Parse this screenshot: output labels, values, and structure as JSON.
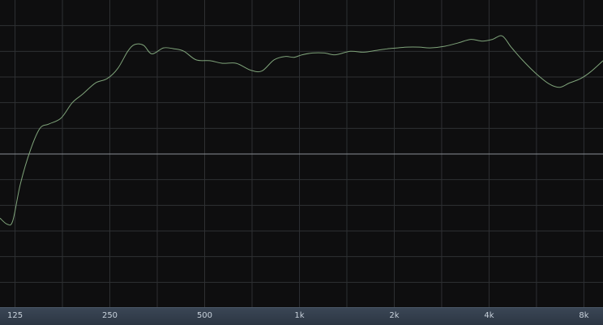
{
  "chart_data": {
    "type": "line",
    "xscale": "log",
    "xlim": [
      112,
      9200
    ],
    "ylim": [
      -18,
      18
    ],
    "grid": true,
    "x_tick_labels": [
      {
        "label": "125",
        "value": 125
      },
      {
        "label": "250",
        "value": 250
      },
      {
        "label": "500",
        "value": 500
      },
      {
        "label": "1k",
        "value": 1000
      },
      {
        "label": "2k",
        "value": 2000
      },
      {
        "label": "4k",
        "value": 4000
      },
      {
        "label": "8k",
        "value": 8000
      }
    ],
    "series": [
      {
        "color": "#7fa37a",
        "x": [
          112,
          118,
          123,
          130,
          140,
          150,
          160,
          175,
          190,
          205,
          225,
          245,
          265,
          285,
          300,
          320,
          340,
          370,
          400,
          430,
          470,
          520,
          570,
          630,
          700,
          760,
          830,
          900,
          960,
          1020,
          1100,
          1200,
          1300,
          1450,
          1600,
          1750,
          1900,
          2050,
          2200,
          2400,
          2600,
          2900,
          3200,
          3500,
          3800,
          4100,
          4400,
          4700,
          5100,
          5600,
          6200,
          6700,
          7200,
          7800,
          8400,
          9200
        ],
        "values": [
          -7.5,
          -8.2,
          -7.8,
          -3.5,
          0.5,
          3.0,
          3.5,
          4.2,
          6.0,
          7.0,
          8.3,
          8.8,
          10.0,
          12.0,
          12.8,
          12.7,
          11.7,
          12.4,
          12.3,
          12.0,
          11.0,
          10.9,
          10.6,
          10.6,
          9.8,
          9.7,
          11.0,
          11.4,
          11.3,
          11.6,
          11.8,
          11.8,
          11.6,
          12.0,
          11.9,
          12.1,
          12.3,
          12.4,
          12.5,
          12.5,
          12.4,
          12.6,
          13.0,
          13.4,
          13.2,
          13.4,
          13.8,
          12.5,
          11.0,
          9.5,
          8.2,
          7.8,
          8.3,
          8.8,
          9.6,
          10.9
        ]
      }
    ]
  }
}
